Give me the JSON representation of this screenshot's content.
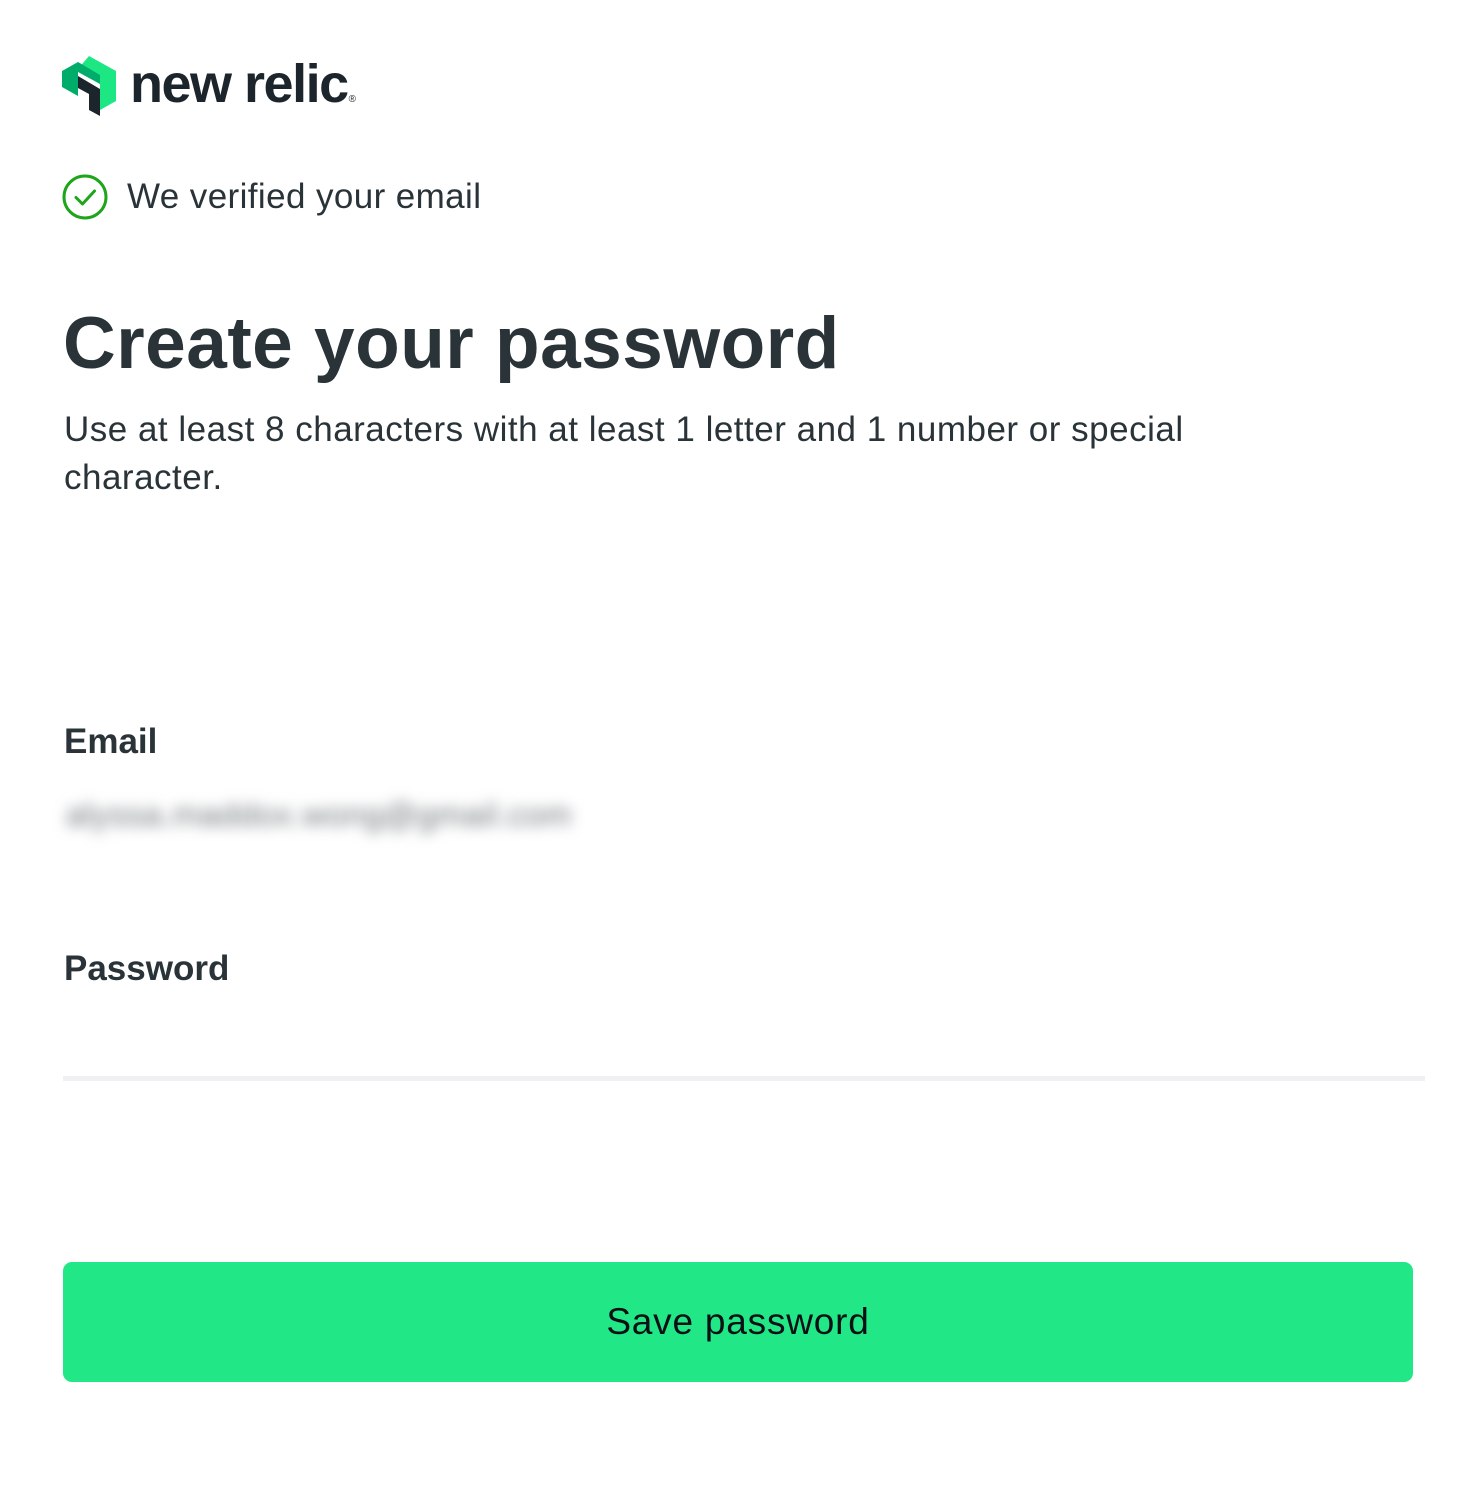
{
  "brand": {
    "name": "new relic",
    "registered_mark": "®",
    "logo_icon": "new-relic-logo-icon",
    "colors": {
      "accent": "#21e786",
      "logo_primary": "#1ce783",
      "logo_dark": "#1d252c",
      "success": "#1da51b"
    }
  },
  "status": {
    "icon": "check-circle-icon",
    "message": "We verified your email"
  },
  "page": {
    "title": "Create your password",
    "subtitle": "Use at least 8 characters with at least 1 letter and 1 number or special character."
  },
  "form": {
    "email": {
      "label": "Email",
      "value": "alyssa.maddox.wong@gmail.com"
    },
    "password": {
      "label": "Password",
      "value": ""
    },
    "submit_label": "Save password"
  }
}
